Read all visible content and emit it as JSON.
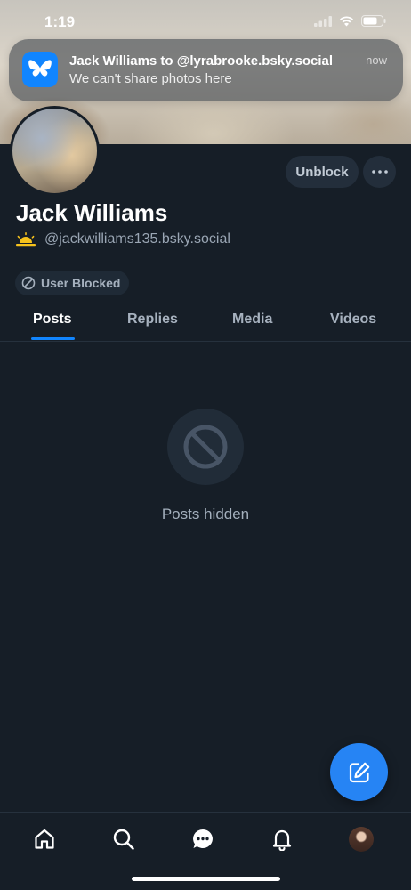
{
  "status_bar": {
    "time": "1:19"
  },
  "notification": {
    "title": "Jack Williams to @lyrabrooke.bsky.social",
    "body": "We can't share photos here",
    "time": "now",
    "app_icon": "butterfly-icon"
  },
  "profile": {
    "display_name": "Jack Williams",
    "handle": "@jackwilliams135.bsky.social",
    "handle_emoji": "sunrise-icon",
    "blocked_label": "User Blocked"
  },
  "actions": {
    "unblock_label": "Unblock"
  },
  "tabs": [
    {
      "label": "Posts",
      "active": true
    },
    {
      "label": "Replies",
      "active": false
    },
    {
      "label": "Media",
      "active": false
    },
    {
      "label": "Videos",
      "active": false
    }
  ],
  "empty_state": {
    "text": "Posts hidden"
  },
  "colors": {
    "background": "#161e27",
    "accent": "#1185fe",
    "fab": "#2684f4",
    "pill": "#232e3b",
    "muted_text": "#9aa6b4"
  },
  "bottom_nav": [
    "home-icon",
    "search-icon",
    "chat-icon",
    "bell-icon",
    "profile-avatar"
  ]
}
